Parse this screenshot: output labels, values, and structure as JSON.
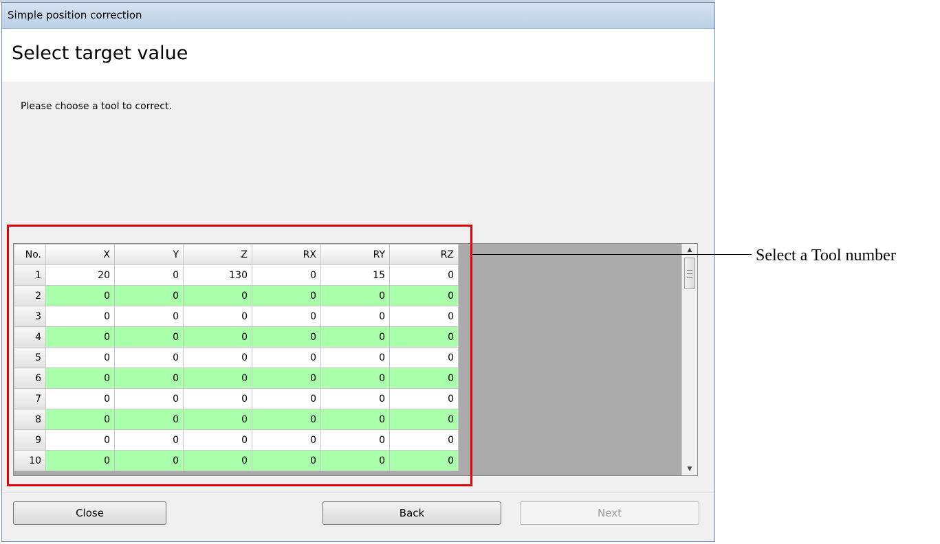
{
  "window": {
    "title": "Simple position correction",
    "heading": "Select target value",
    "instruction": "Please choose a tool to correct."
  },
  "table": {
    "columns": [
      "No.",
      "X",
      "Y",
      "Z",
      "RX",
      "RY",
      "RZ"
    ],
    "rows": [
      [
        "1",
        "20",
        "0",
        "130",
        "0",
        "15",
        "0"
      ],
      [
        "2",
        "0",
        "0",
        "0",
        "0",
        "0",
        "0"
      ],
      [
        "3",
        "0",
        "0",
        "0",
        "0",
        "0",
        "0"
      ],
      [
        "4",
        "0",
        "0",
        "0",
        "0",
        "0",
        "0"
      ],
      [
        "5",
        "0",
        "0",
        "0",
        "0",
        "0",
        "0"
      ],
      [
        "6",
        "0",
        "0",
        "0",
        "0",
        "0",
        "0"
      ],
      [
        "7",
        "0",
        "0",
        "0",
        "0",
        "0",
        "0"
      ],
      [
        "8",
        "0",
        "0",
        "0",
        "0",
        "0",
        "0"
      ],
      [
        "9",
        "0",
        "0",
        "0",
        "0",
        "0",
        "0"
      ],
      [
        "10",
        "0",
        "0",
        "0",
        "0",
        "0",
        "0"
      ]
    ]
  },
  "annotation": {
    "callout": "Select a Tool number",
    "highlight_color": "#e60000"
  },
  "buttons": {
    "close": "Close",
    "back": "Back",
    "next": "Next"
  },
  "colors": {
    "row_alt": "#aaffaa",
    "grid_background": "#ababab",
    "title_bar": "#c9d9ec"
  },
  "icons": {
    "scroll_up": "up-arrow-icon",
    "scroll_down": "down-arrow-icon"
  }
}
